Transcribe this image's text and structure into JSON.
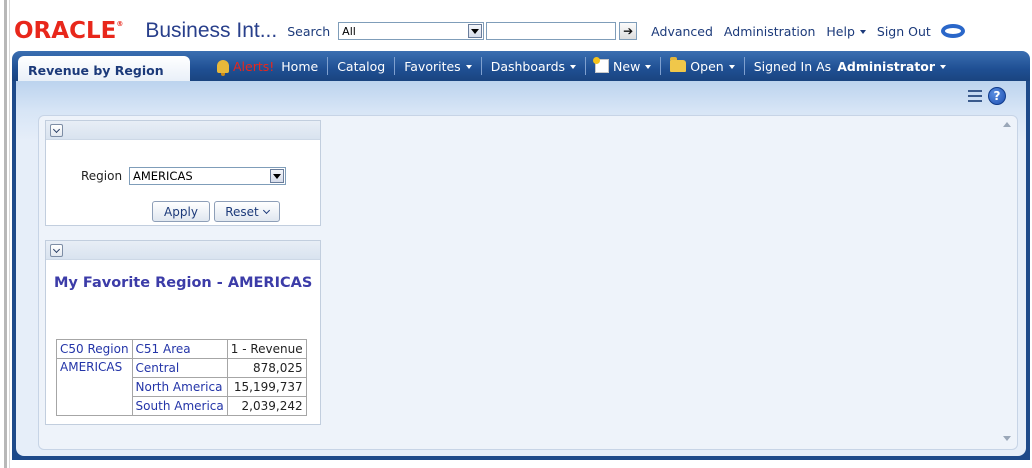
{
  "header": {
    "logo_text": "ORACLE",
    "logo_reg": "®",
    "product": "Business Int...",
    "search_label": "Search",
    "search_scope": "All",
    "search_query": "",
    "go_arrow": "➔",
    "advanced": "Advanced",
    "administration": "Administration",
    "help": "Help",
    "sign_out": "Sign Out"
  },
  "nav": {
    "dashboard_tab": "Revenue by Region",
    "alerts": "Alerts!",
    "home": "Home",
    "catalog": "Catalog",
    "favorites": "Favorites",
    "dashboards": "Dashboards",
    "new": "New",
    "open": "Open",
    "signed_in_as": "Signed In As",
    "user": "Administrator"
  },
  "prompt": {
    "label": "Region",
    "selected": "AMERICAS",
    "apply": "Apply",
    "reset": "Reset"
  },
  "report": {
    "title": "My Favorite Region - AMERICAS",
    "columns": [
      "C50 Region",
      "C51 Area",
      "1 - Revenue"
    ],
    "region": "AMERICAS",
    "rows": [
      {
        "area": "Central",
        "revenue": "878,025"
      },
      {
        "area": "North America",
        "revenue": "15,199,737"
      },
      {
        "area": "South America",
        "revenue": "2,039,242"
      }
    ]
  },
  "colors": {
    "oracle_red": "#e8271b",
    "nav_blue": "#1f4f93",
    "link_blue": "#2435a8"
  },
  "icons": [
    "alert-bell-icon",
    "new-icon",
    "open-folder-icon",
    "page-options-icon",
    "help-icon",
    "collapse-icon",
    "dropdown-arrow-icon",
    "go-arrow-icon",
    "oracle-o-icon"
  ]
}
